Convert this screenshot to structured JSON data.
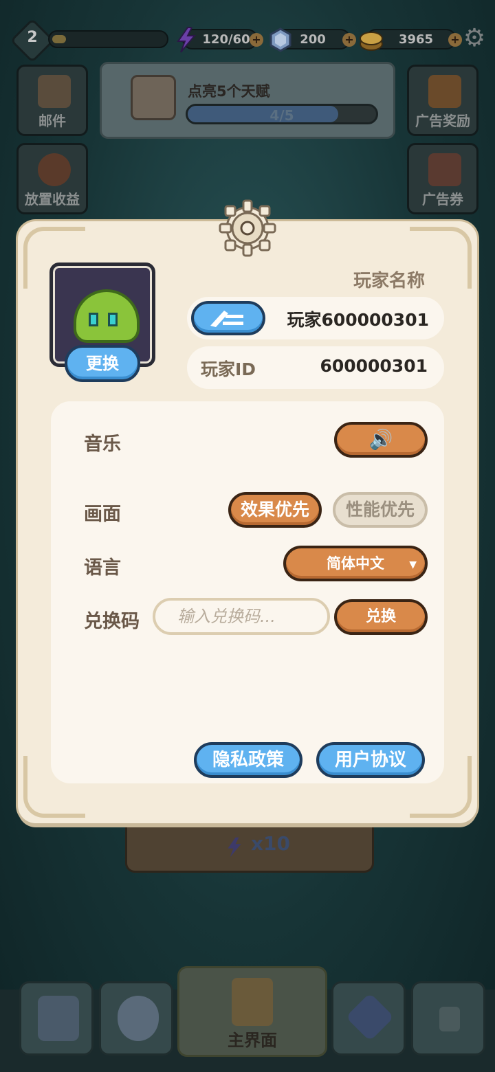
{
  "topbar": {
    "level": "2",
    "energy": "120/60",
    "gems": "200",
    "coins": "3965"
  },
  "side": {
    "mail": "邮件",
    "idle_income": "放置收益",
    "ad_reward": "广告奖励",
    "ad_ticket": "广告券"
  },
  "quest": {
    "title": "点亮5个天赋",
    "progress_text": "4/5",
    "progress": 0.8
  },
  "background": {
    "card_label": "x10"
  },
  "dialog": {
    "player_name_label": "玩家名称",
    "player_name": "玩家600000301",
    "player_id_label": "玩家ID",
    "player_id": "600000301",
    "change_avatar": "更换",
    "music_label": "音乐",
    "graphics_label": "画面",
    "graphics_quality": "效果优先",
    "graphics_performance": "性能优先",
    "language_label": "语言",
    "language_value": "简体中文",
    "code_label": "兑换码",
    "code_placeholder": "输入兑换码...",
    "redeem": "兑换",
    "privacy": "隐私政策",
    "agreement": "用户协议"
  },
  "nav": {
    "main": "主界面"
  },
  "colors": {
    "accent_orange": "#d9894a",
    "accent_blue": "#5fb2f0",
    "panel_bg": "#f4ebda"
  }
}
